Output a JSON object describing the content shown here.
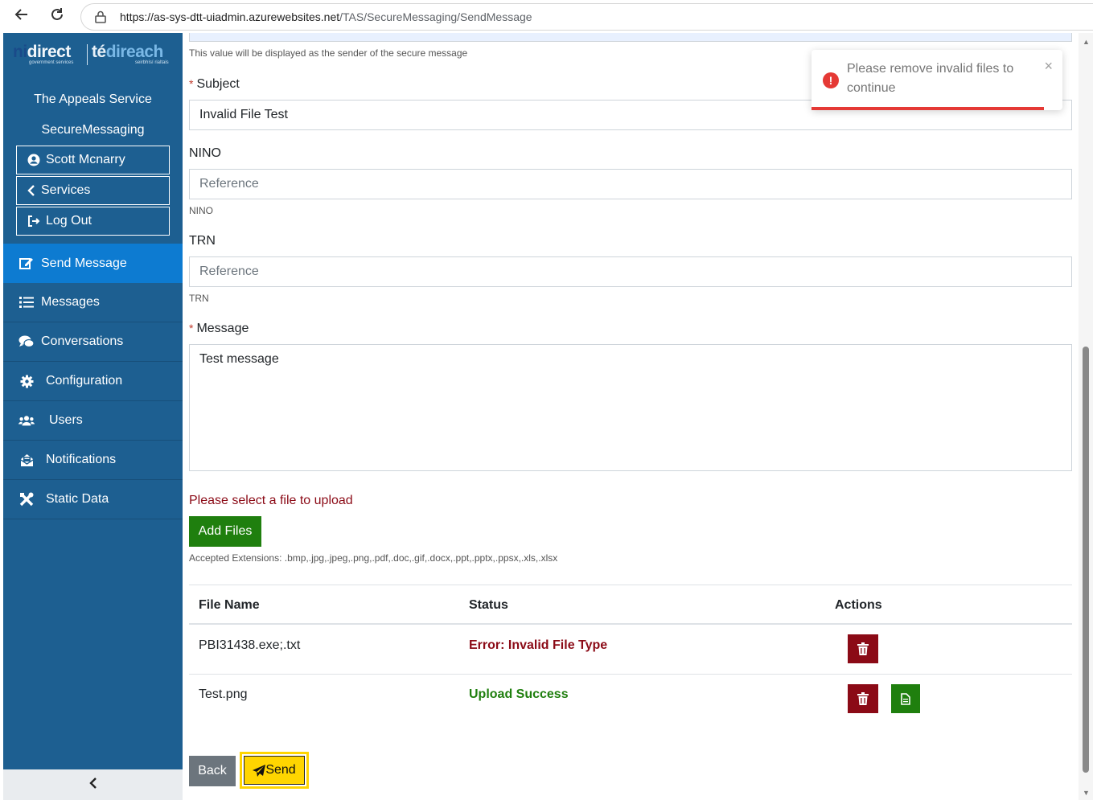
{
  "browser": {
    "url_host": "https://as-sys-dtt-uiadmin.azurewebsites.net",
    "url_path": "/TAS/SecureMessaging/SendMessage"
  },
  "sidebar": {
    "logo_left_a": "ni",
    "logo_left_b": "direct",
    "logo_left_sub": "government services",
    "logo_right_a": "té",
    "logo_right_b": "direach",
    "logo_right_sub": "seirbhísí rialtais",
    "service_name": "The Appeals Service",
    "module_name": "SecureMessaging",
    "user_name": "Scott Mcnarry",
    "services_label": "Services",
    "logout_label": "Log Out",
    "items": [
      {
        "label": "Send Message",
        "icon": "edit-icon"
      },
      {
        "label": "Messages",
        "icon": "list-icon"
      },
      {
        "label": "Conversations",
        "icon": "comments-icon"
      },
      {
        "label": "Configuration",
        "icon": "gear-icon"
      },
      {
        "label": "Users",
        "icon": "users-icon"
      },
      {
        "label": "Notifications",
        "icon": "envelope-open-icon"
      },
      {
        "label": "Static Data",
        "icon": "tools-icon"
      }
    ]
  },
  "form": {
    "sender_help": "This value will be displayed as the sender of the secure message",
    "subject_label": "Subject",
    "subject_value": "Invalid File Test",
    "nino_label": "NINO",
    "nino_placeholder": "Reference",
    "nino_help": "NINO",
    "trn_label": "TRN",
    "trn_placeholder": "Reference",
    "trn_help": "TRN",
    "message_label": "Message",
    "message_value": "Test message",
    "required_mark": "*",
    "file_error": "Please select a file to upload",
    "add_files_label": "Add Files",
    "accepted_ext": "Accepted Extensions: .bmp,.jpg,.jpeg,.png,.pdf,.doc,.gif,.docx,.ppt,.pptx,.ppsx,.xls,.xlsx"
  },
  "files_table": {
    "headers": [
      "File Name",
      "Status",
      "Actions"
    ],
    "rows": [
      {
        "name": "PBI31438.exe;.txt",
        "status": "Error: Invalid File Type",
        "status_type": "error"
      },
      {
        "name": "Test.png",
        "status": "Upload Success",
        "status_type": "success"
      }
    ]
  },
  "buttons": {
    "back_label": "Back",
    "send_label": "Send"
  },
  "toast": {
    "message": "Please remove invalid files to continue",
    "close": "×",
    "icon": "!"
  },
  "colors": {
    "sidebar": "#1d5f91",
    "active_item": "#0d7bd1",
    "success": "#1f7f0e",
    "danger": "#8b0a16",
    "send_highlight": "#ffd500",
    "toast_error": "#e53935"
  }
}
